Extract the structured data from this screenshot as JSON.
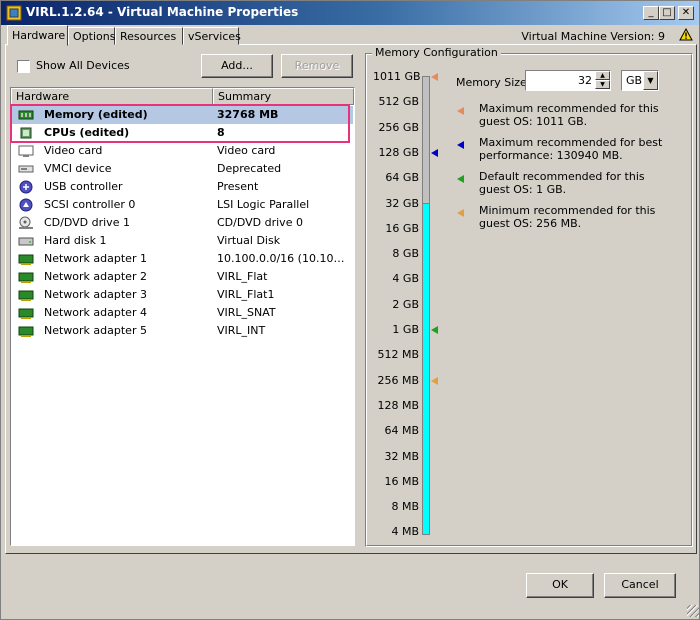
{
  "window": {
    "title": "VIRL.1.2.64 - Virtual Machine Properties",
    "controls": {
      "minimize": "_",
      "maximize": "□",
      "close": "✕"
    }
  },
  "tabs": [
    {
      "label": "Hardware",
      "active": true
    },
    {
      "label": "Options",
      "active": false
    },
    {
      "label": "Resources",
      "active": false
    },
    {
      "label": "vServices",
      "active": false
    }
  ],
  "vm_version": "Virtual Machine Version: 9",
  "show_all_devices": {
    "label": "Show All Devices",
    "checked": false
  },
  "buttons": {
    "add": "Add...",
    "remove": "Remove",
    "ok": "OK",
    "cancel": "Cancel"
  },
  "hardware_table": {
    "headers": {
      "hardware": "Hardware",
      "summary": "Summary"
    },
    "rows": [
      {
        "name": "Memory (edited)",
        "summary": "32768 MB",
        "icon": "memory-icon",
        "bold": true,
        "selected": true
      },
      {
        "name": "CPUs (edited)",
        "summary": "8",
        "icon": "cpu-icon",
        "bold": true,
        "selected": false
      },
      {
        "name": "Video card",
        "summary": "Video card",
        "icon": "video-card-icon"
      },
      {
        "name": "VMCI device",
        "summary": "Deprecated",
        "icon": "vmci-device-icon"
      },
      {
        "name": "USB controller",
        "summary": "Present",
        "icon": "usb-controller-icon"
      },
      {
        "name": "SCSI controller 0",
        "summary": "LSI Logic Parallel",
        "icon": "scsi-controller-icon"
      },
      {
        "name": "CD/DVD drive 1",
        "summary": "CD/DVD drive 0",
        "icon": "cd-dvd-drive-icon"
      },
      {
        "name": "Hard disk 1",
        "summary": "Virtual Disk",
        "icon": "hard-disk-icon"
      },
      {
        "name": "Network adapter 1",
        "summary": "10.100.0.0/16 (10.100....",
        "icon": "network-adapter-icon"
      },
      {
        "name": "Network adapter 2",
        "summary": "VIRL_Flat",
        "icon": "network-adapter-icon"
      },
      {
        "name": "Network adapter 3",
        "summary": "VIRL_Flat1",
        "icon": "network-adapter-icon"
      },
      {
        "name": "Network adapter 4",
        "summary": "VIRL_SNAT",
        "icon": "network-adapter-icon"
      },
      {
        "name": "Network adapter 5",
        "summary": "VIRL_INT",
        "icon": "network-adapter-icon"
      }
    ]
  },
  "memory_config": {
    "group_title": "Memory Configuration",
    "scale_labels": [
      "1011 GB",
      "512 GB",
      "256 GB",
      "128 GB",
      "64 GB",
      "32 GB",
      "16 GB",
      "8 GB",
      "4 GB",
      "2 GB",
      "1 GB",
      "512 MB",
      "256 MB",
      "128 MB",
      "64 MB",
      "32 MB",
      "16 MB",
      "8 MB",
      "4 MB"
    ],
    "current_level": "32 GB",
    "fill_color": "#00ffff",
    "memory_size": {
      "label": "Memory Size:",
      "value": "32",
      "unit": "GB"
    },
    "legend": [
      {
        "line1": "Maximum recommended for this",
        "line2": "guest OS: 1011 GB.",
        "color": "#e88a5a",
        "level": "1011 GB"
      },
      {
        "line1": "Maximum recommended for best",
        "line2": "performance: 130940 MB.",
        "color": "#0000c8",
        "level": "128 GB"
      },
      {
        "line1": "Default recommended for this",
        "line2": "guest OS: 1 GB.",
        "color": "#20a020",
        "level": "1 GB"
      },
      {
        "line1": "Minimum recommended for this",
        "line2": "guest OS: 256 MB.",
        "color": "#e0a040",
        "level": "256 MB"
      }
    ]
  },
  "colors": {
    "selection": "#b4c8e4",
    "highlight_box": "#e8327a",
    "titlebar": "#0a246a"
  }
}
